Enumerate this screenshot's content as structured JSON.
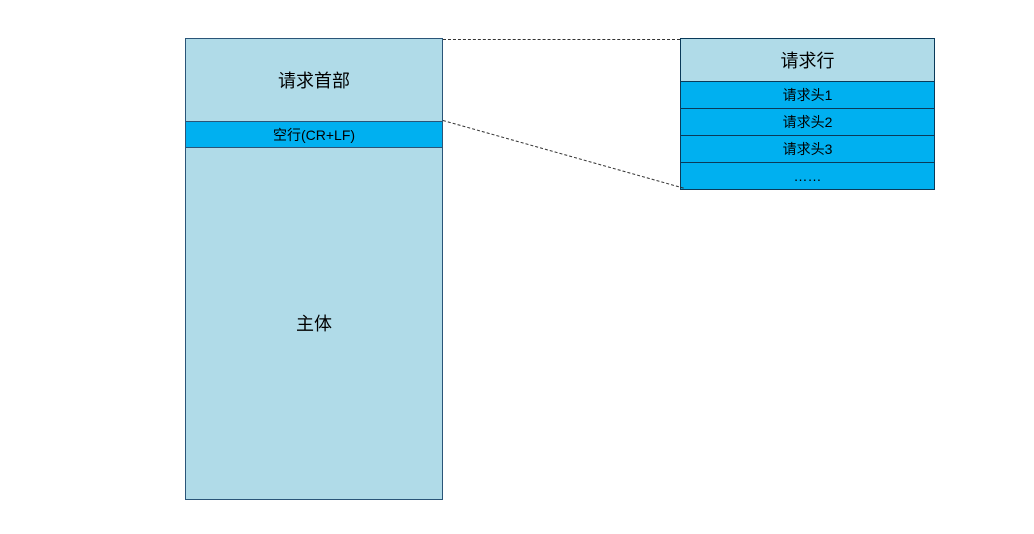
{
  "left": {
    "header": "请求首部",
    "blank": "空行(CR+LF)",
    "body": "主体"
  },
  "right": {
    "request_line": "请求行",
    "headers": [
      "请求头1",
      "请求头2",
      "请求头3",
      "……"
    ]
  }
}
